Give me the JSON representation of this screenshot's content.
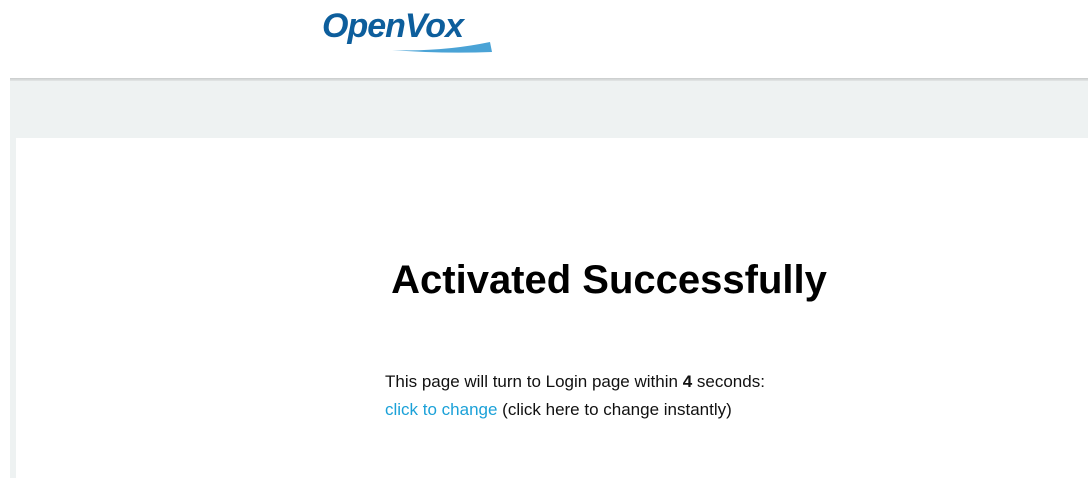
{
  "header": {
    "logo_text": "OpenVox"
  },
  "main": {
    "title": "Activated Successfully",
    "message_prefix": "This page will turn to Login page within ",
    "countdown": "4",
    "message_suffix": " seconds:",
    "link_label": "click to change",
    "link_note": " (click here to change instantly)"
  },
  "colors": {
    "brand": "#0d5e9c",
    "swoosh": "#4aa3d6",
    "link": "#1ba1d8",
    "band": "#eef2f2"
  }
}
